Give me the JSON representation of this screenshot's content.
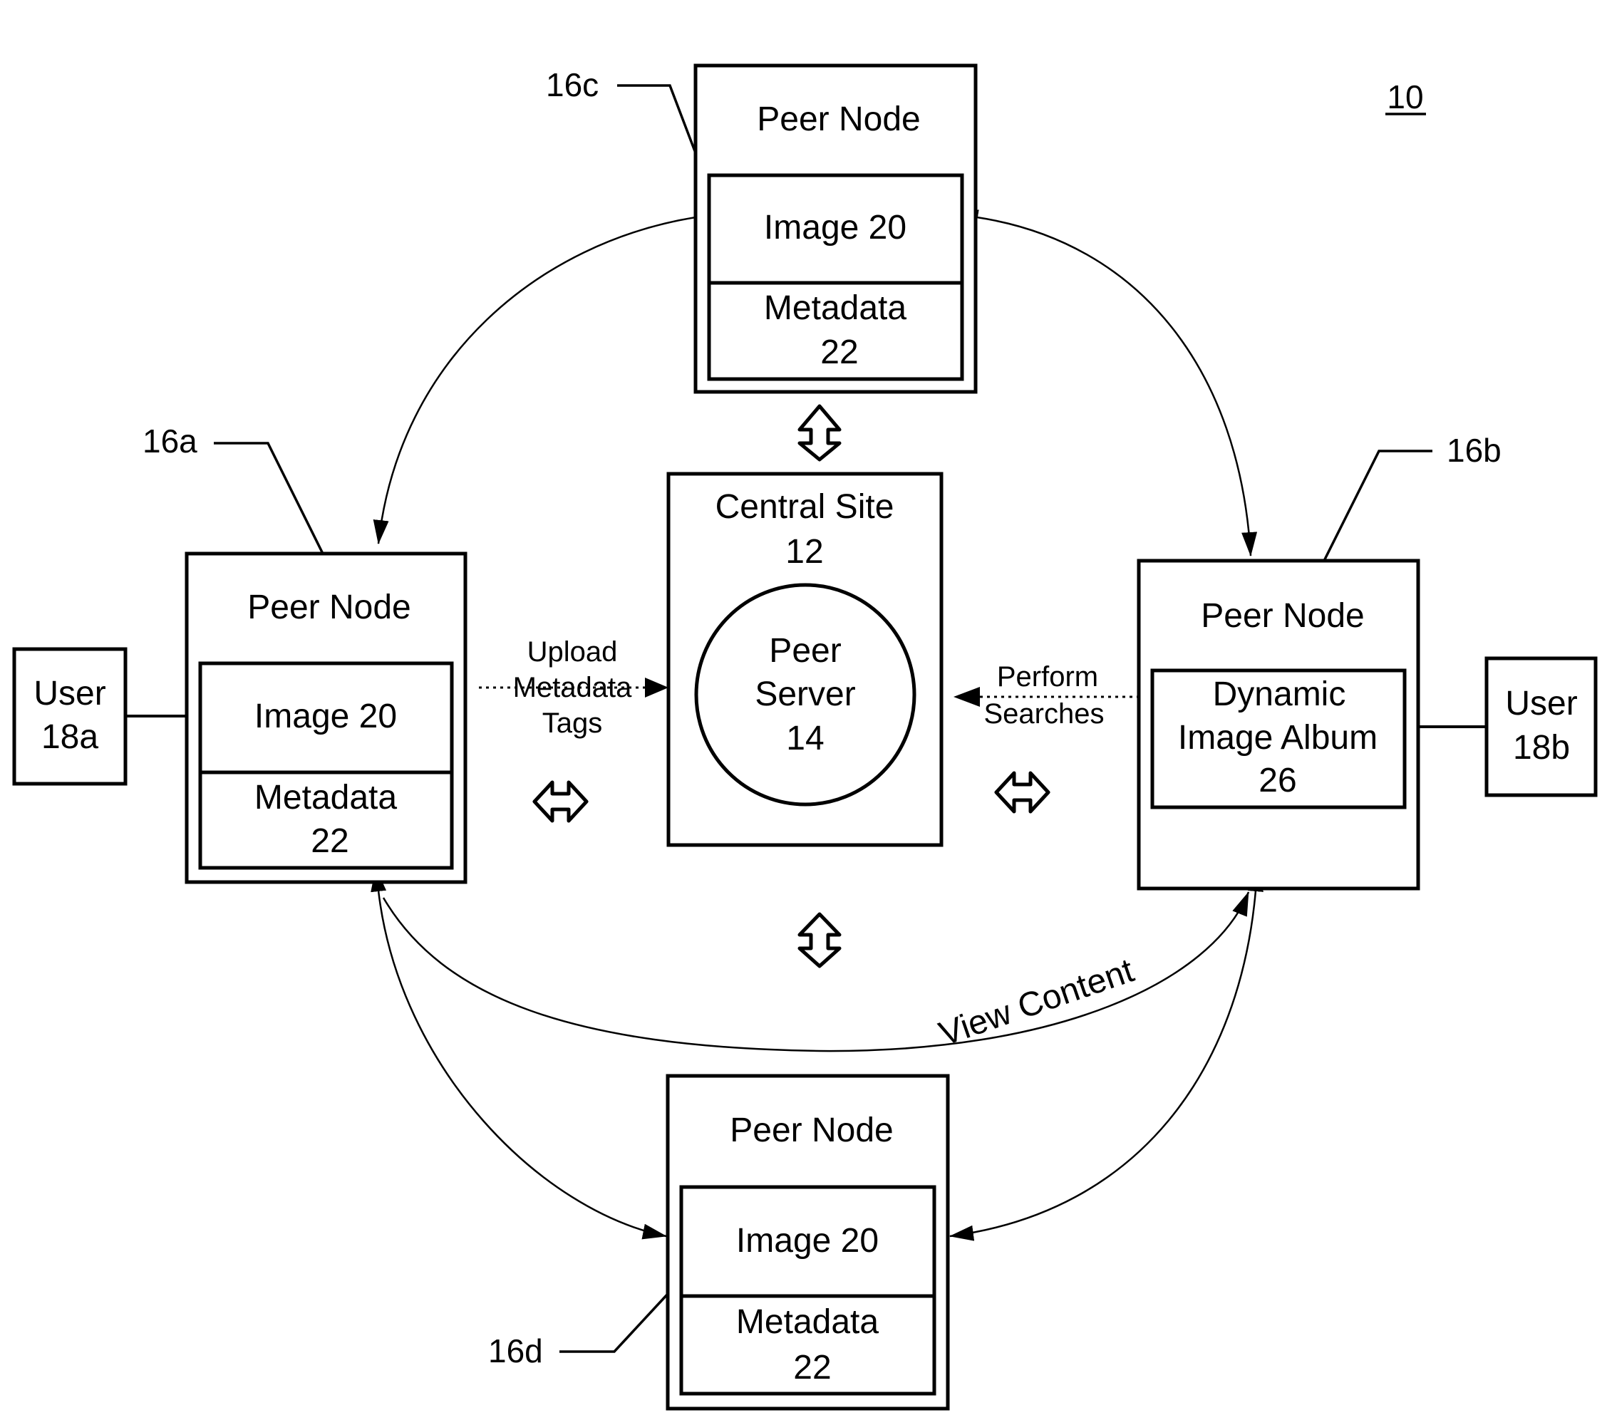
{
  "figure": {
    "reference_number": "10"
  },
  "central_site": {
    "title": "Central Site",
    "ref": "12",
    "server": {
      "line1": "Peer",
      "line2": "Server",
      "ref": "14"
    }
  },
  "peer_nodes": {
    "c": {
      "ref_label": "16c",
      "title": "Peer Node",
      "image_label": "Image 20",
      "metadata_label": "Metadata",
      "metadata_ref": "22"
    },
    "a": {
      "ref_label": "16a",
      "title": "Peer Node",
      "image_label": "Image 20",
      "metadata_label": "Metadata",
      "metadata_ref": "22"
    },
    "b": {
      "ref_label": "16b",
      "title": "Peer Node",
      "album_line1": "Dynamic",
      "album_line2": "Image Album",
      "album_ref": "26"
    },
    "d": {
      "ref_label": "16d",
      "title": "Peer Node",
      "image_label": "Image 20",
      "metadata_label": "Metadata",
      "metadata_ref": "22"
    }
  },
  "users": {
    "a": {
      "line1": "User",
      "line2": "18a"
    },
    "b": {
      "line1": "User",
      "line2": "18b"
    }
  },
  "flows": {
    "upload": {
      "line1": "Upload",
      "line2": "Metadata",
      "line3": "Tags"
    },
    "search": {
      "line1": "Perform",
      "line2": "Searches"
    },
    "view": {
      "label": "View Content"
    }
  },
  "colors": {
    "ink": "#000000",
    "paper": "#ffffff"
  }
}
